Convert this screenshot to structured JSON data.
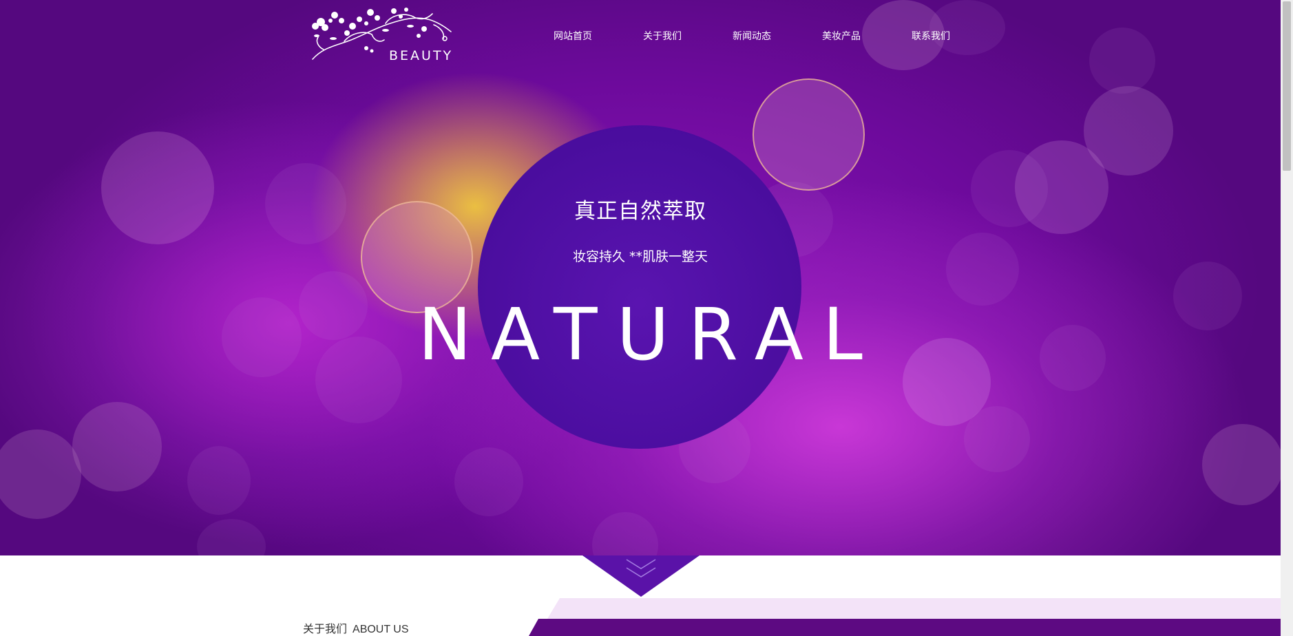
{
  "header": {
    "logo_text": "BEAUTY",
    "nav": [
      {
        "label": "网站首页"
      },
      {
        "label": "关于我们"
      },
      {
        "label": "新闻动态"
      },
      {
        "label": "美妆产品"
      },
      {
        "label": "联系我们"
      }
    ]
  },
  "hero": {
    "title": "真正自然萃取",
    "subtitle": "妆容持久 **肌肤一整天",
    "big_word": "NATURAL"
  },
  "about": {
    "label_cn": "关于我们",
    "label_en": "ABOUT US"
  },
  "colors": {
    "primary_purple": "#6d0a9c",
    "disc_purple": "#4a0d9e",
    "strip_light": "#f3e3f8",
    "strip_dark": "#5d0a82"
  },
  "icons": {
    "logo": "floral-vine-icon",
    "scroll_down": "double-chevron-down-icon"
  }
}
